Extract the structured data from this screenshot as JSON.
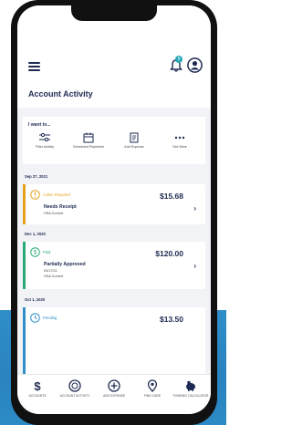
{
  "header": {
    "title": "Account Activity",
    "notification_count": "9"
  },
  "quick_actions": {
    "heading": "I want to...",
    "items": [
      {
        "label": "Filter Activity",
        "icon": "sliders-icon"
      },
      {
        "label": "Scheduled Payments",
        "icon": "calendar-icon"
      },
      {
        "label": "Add Expense",
        "icon": "receipt-icon"
      },
      {
        "label": "See More",
        "icon": "more-dots-icon"
      }
    ]
  },
  "activity": [
    {
      "date": "Sep 27, 2021",
      "status": "Action Required",
      "status_color": "#e6a21a",
      "title": "Needs Receipt",
      "sub1": "HSA Current",
      "sub2": "",
      "amount": "$15.68"
    },
    {
      "date": "Dec 1, 2020",
      "status": "Paid",
      "status_color": "#2aa876",
      "title": "Partially Approved",
      "sub1": "03/17/21",
      "sub2": "HSA Current",
      "amount": "$120.00"
    },
    {
      "date": "Oct 1, 2020",
      "status": "Pending",
      "status_color": "#2f8ec8",
      "title": "",
      "sub1": "",
      "sub2": "",
      "amount": "$13.50"
    }
  ],
  "bottom_nav": [
    {
      "label": "ACCOUNTS",
      "icon": "dollar-icon"
    },
    {
      "label": "ACCOUNT ACTIVITY",
      "icon": "activity-icon"
    },
    {
      "label": "ADD EXPENSE",
      "icon": "plus-circle-icon"
    },
    {
      "label": "FIND CARE",
      "icon": "location-pin-icon"
    },
    {
      "label": "FUNDING CALCULATOR",
      "icon": "piggy-bank-icon"
    }
  ],
  "colors": {
    "navy": "#1e2a52",
    "accent_blue": "#2f8ec8",
    "warning": "#e6a21a",
    "success": "#2aa876"
  }
}
